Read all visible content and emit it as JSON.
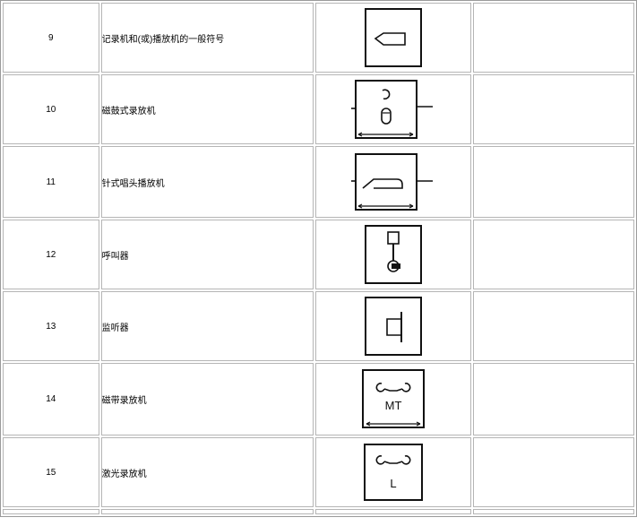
{
  "rows": [
    {
      "no": "9",
      "name": "记录机和(或)播放机的一般符号",
      "symbol_icon": "tape-recorder-general-symbol-icon",
      "note": ""
    },
    {
      "no": "10",
      "name": "磁鼓式录放机",
      "symbol_icon": "drum-recorder-symbol-icon",
      "note": ""
    },
    {
      "no": "11",
      "name": "针式唱头播放机",
      "symbol_icon": "needle-pickup-player-symbol-icon",
      "note": ""
    },
    {
      "no": "12",
      "name": "呼叫器",
      "symbol_icon": "pager-symbol-icon",
      "note": ""
    },
    {
      "no": "13",
      "name": "监听器",
      "symbol_icon": "monitor-listener-symbol-icon",
      "note": ""
    },
    {
      "no": "14",
      "name": "磁带录放机",
      "symbol_icon": "magnetic-tape-recorder-symbol-icon",
      "symbol_text": "MT",
      "note": ""
    },
    {
      "no": "15",
      "name": "激光录放机",
      "symbol_icon": "laser-recorder-symbol-icon",
      "symbol_text": "L",
      "note": ""
    }
  ]
}
